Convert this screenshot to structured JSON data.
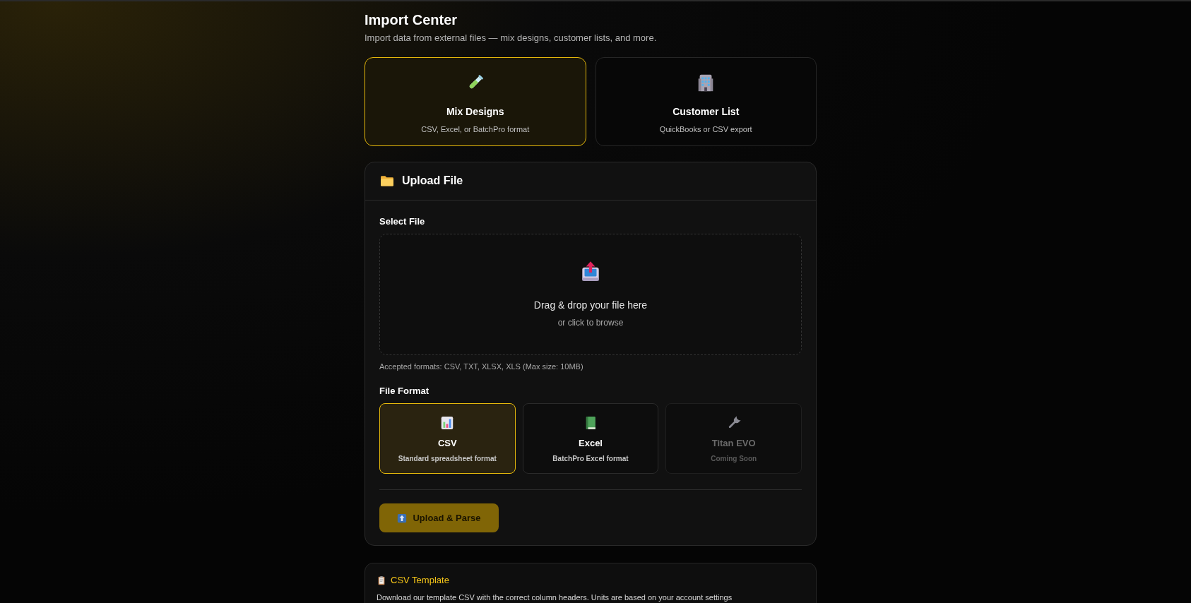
{
  "header": {
    "title": "Import Center",
    "subtitle": "Import data from external files — mix designs, customer lists, and more."
  },
  "import_types": [
    {
      "title": "Mix Designs",
      "description": "CSV, Excel, or BatchPro format",
      "selected": true
    },
    {
      "title": "Customer List",
      "description": "QuickBooks or CSV export",
      "selected": false
    }
  ],
  "upload_panel": {
    "title": "Upload File",
    "select_label": "Select File",
    "dropzone": {
      "title": "Drag & drop your file here",
      "hint": "or click to browse"
    },
    "accepted_formats": "Accepted formats: CSV, TXT, XLSX, XLS (Max size: 10MB)",
    "format_label": "File Format",
    "formats": [
      {
        "title": "CSV",
        "description": "Standard spreadsheet format",
        "selected": true,
        "disabled": false
      },
      {
        "title": "Excel",
        "description": "BatchPro Excel format",
        "selected": false,
        "disabled": false
      },
      {
        "title": "Titan EVO",
        "description": "Coming Soon",
        "selected": false,
        "disabled": true
      }
    ],
    "button": "Upload & Parse"
  },
  "template_card": {
    "title": "CSV Template",
    "description": "Download our template CSV with the correct column headers. Units are based on your account settings"
  }
}
